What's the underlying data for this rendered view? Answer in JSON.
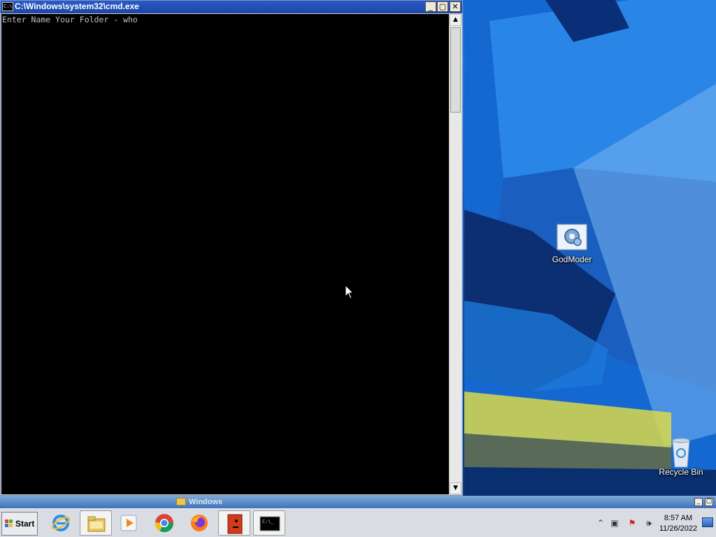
{
  "cmd_window": {
    "title": "C:\\Windows\\system32\\cmd.exe",
    "icon_label": "C:\\",
    "console_text": "Enter Name Your Folder - who",
    "controls": {
      "minimize": "_",
      "maximize": "▢",
      "close": "✕"
    }
  },
  "minimized_window": {
    "label": "Windows"
  },
  "desktop": {
    "icons": [
      {
        "label": "GodModer",
        "icon": "settings-gear-icon"
      },
      {
        "label": "Recycle Bin",
        "icon": "recycle-bin-icon"
      }
    ]
  },
  "taskbar": {
    "start_label": "Start",
    "apps": [
      {
        "name": "internet-explorer",
        "icon": "ie-icon"
      },
      {
        "name": "file-explorer",
        "icon": "folder-icon"
      },
      {
        "name": "media-player",
        "icon": "media-player-icon"
      },
      {
        "name": "chrome",
        "icon": "chrome-icon"
      },
      {
        "name": "firefox",
        "icon": "firefox-icon"
      },
      {
        "name": "app-red",
        "icon": "red-face-icon"
      },
      {
        "name": "cmd",
        "icon": "cmd-icon"
      }
    ],
    "tray": {
      "time": "8:57 AM",
      "date": "11/26/2022"
    }
  },
  "colors": {
    "titlebar": "#1d46a8",
    "console_bg": "#000000",
    "console_fg": "#c0c0c0",
    "taskbar_bg": "#d9dde3"
  }
}
